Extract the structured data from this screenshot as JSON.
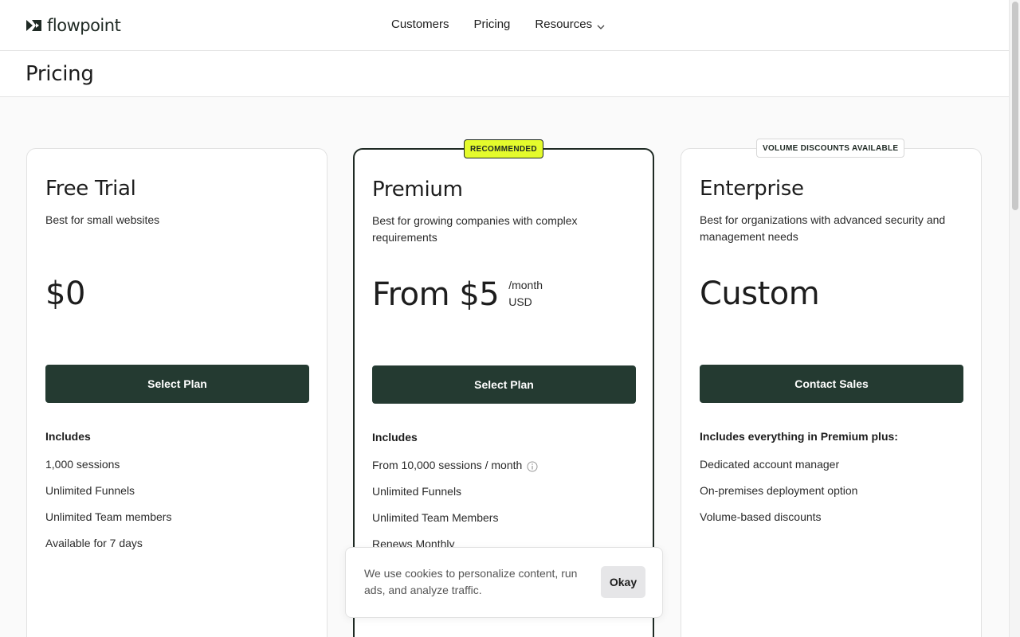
{
  "brand": {
    "name": "flowpoint",
    "color": "#1f2a24"
  },
  "nav": {
    "items": [
      "Customers",
      "Pricing",
      "Resources"
    ]
  },
  "page": {
    "title": "Pricing"
  },
  "plans": [
    {
      "name": "Free Trial",
      "description": "Best for small websites",
      "price": "$0",
      "price_unit_1": "",
      "price_unit_2": "",
      "button": "Select Plan",
      "features_heading": "Includes",
      "features": [
        "1,000 sessions",
        "Unlimited Funnels",
        "Unlimited Team members",
        "Available for 7 days"
      ]
    },
    {
      "name": "Premium",
      "badge": "RECOMMENDED",
      "description": "Best for growing companies with complex requirements",
      "price": "From $5",
      "price_unit_1": "/month",
      "price_unit_2": "USD",
      "button": "Select Plan",
      "features_heading": "Includes",
      "features": [
        "From 10,000 sessions / month",
        "Unlimited Funnels",
        "Unlimited Team Members",
        "Renews Monthly"
      ]
    },
    {
      "name": "Enterprise",
      "badge": "VOLUME DISCOUNTS AVAILABLE",
      "description": "Best for organizations with advanced security and management needs",
      "price": "Custom",
      "button": "Contact Sales",
      "features_heading": "Includes everything in Premium plus:",
      "features": [
        "Dedicated account manager",
        "On-premises deployment option",
        "Volume-based discounts"
      ]
    }
  ],
  "cookie": {
    "text": "We use cookies to personalize content, run ads, and analyze traffic.",
    "button": "Okay"
  },
  "colors": {
    "button_bg": "#243a31",
    "badge_accent": "#e4fb2c"
  },
  "icons": [
    "logo-mark-icon",
    "chevron-down-icon",
    "info-icon"
  ]
}
